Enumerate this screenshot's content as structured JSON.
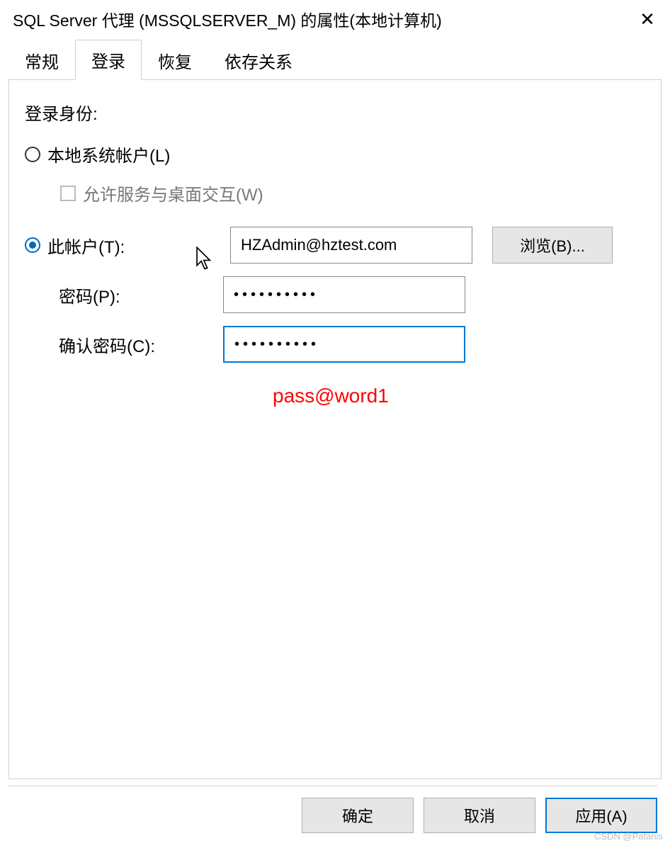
{
  "title": "SQL Server 代理 (MSSQLSERVER_M) 的属性(本地计算机)",
  "tabs": [
    {
      "label": "常规",
      "active": false
    },
    {
      "label": "登录",
      "active": true
    },
    {
      "label": "恢复",
      "active": false
    },
    {
      "label": "依存关系",
      "active": false
    }
  ],
  "section_label": "登录身份:",
  "local_account_label": "本地系统帐户(L)",
  "interact_desktop_label": "允许服务与桌面交互(W)",
  "this_account_label": "此帐户(T):",
  "account_value": "HZAdmin@hztest.com",
  "browse_label": "浏览(B)...",
  "password_label": "密码(P):",
  "password_value": "••••••••••",
  "confirm_label": "确认密码(C):",
  "confirm_value": "••••••••••",
  "annotation_text": "pass@word1",
  "buttons": {
    "ok": "确定",
    "cancel": "取消",
    "apply": "应用(A)"
  },
  "watermark": "CSDN @Patanis"
}
